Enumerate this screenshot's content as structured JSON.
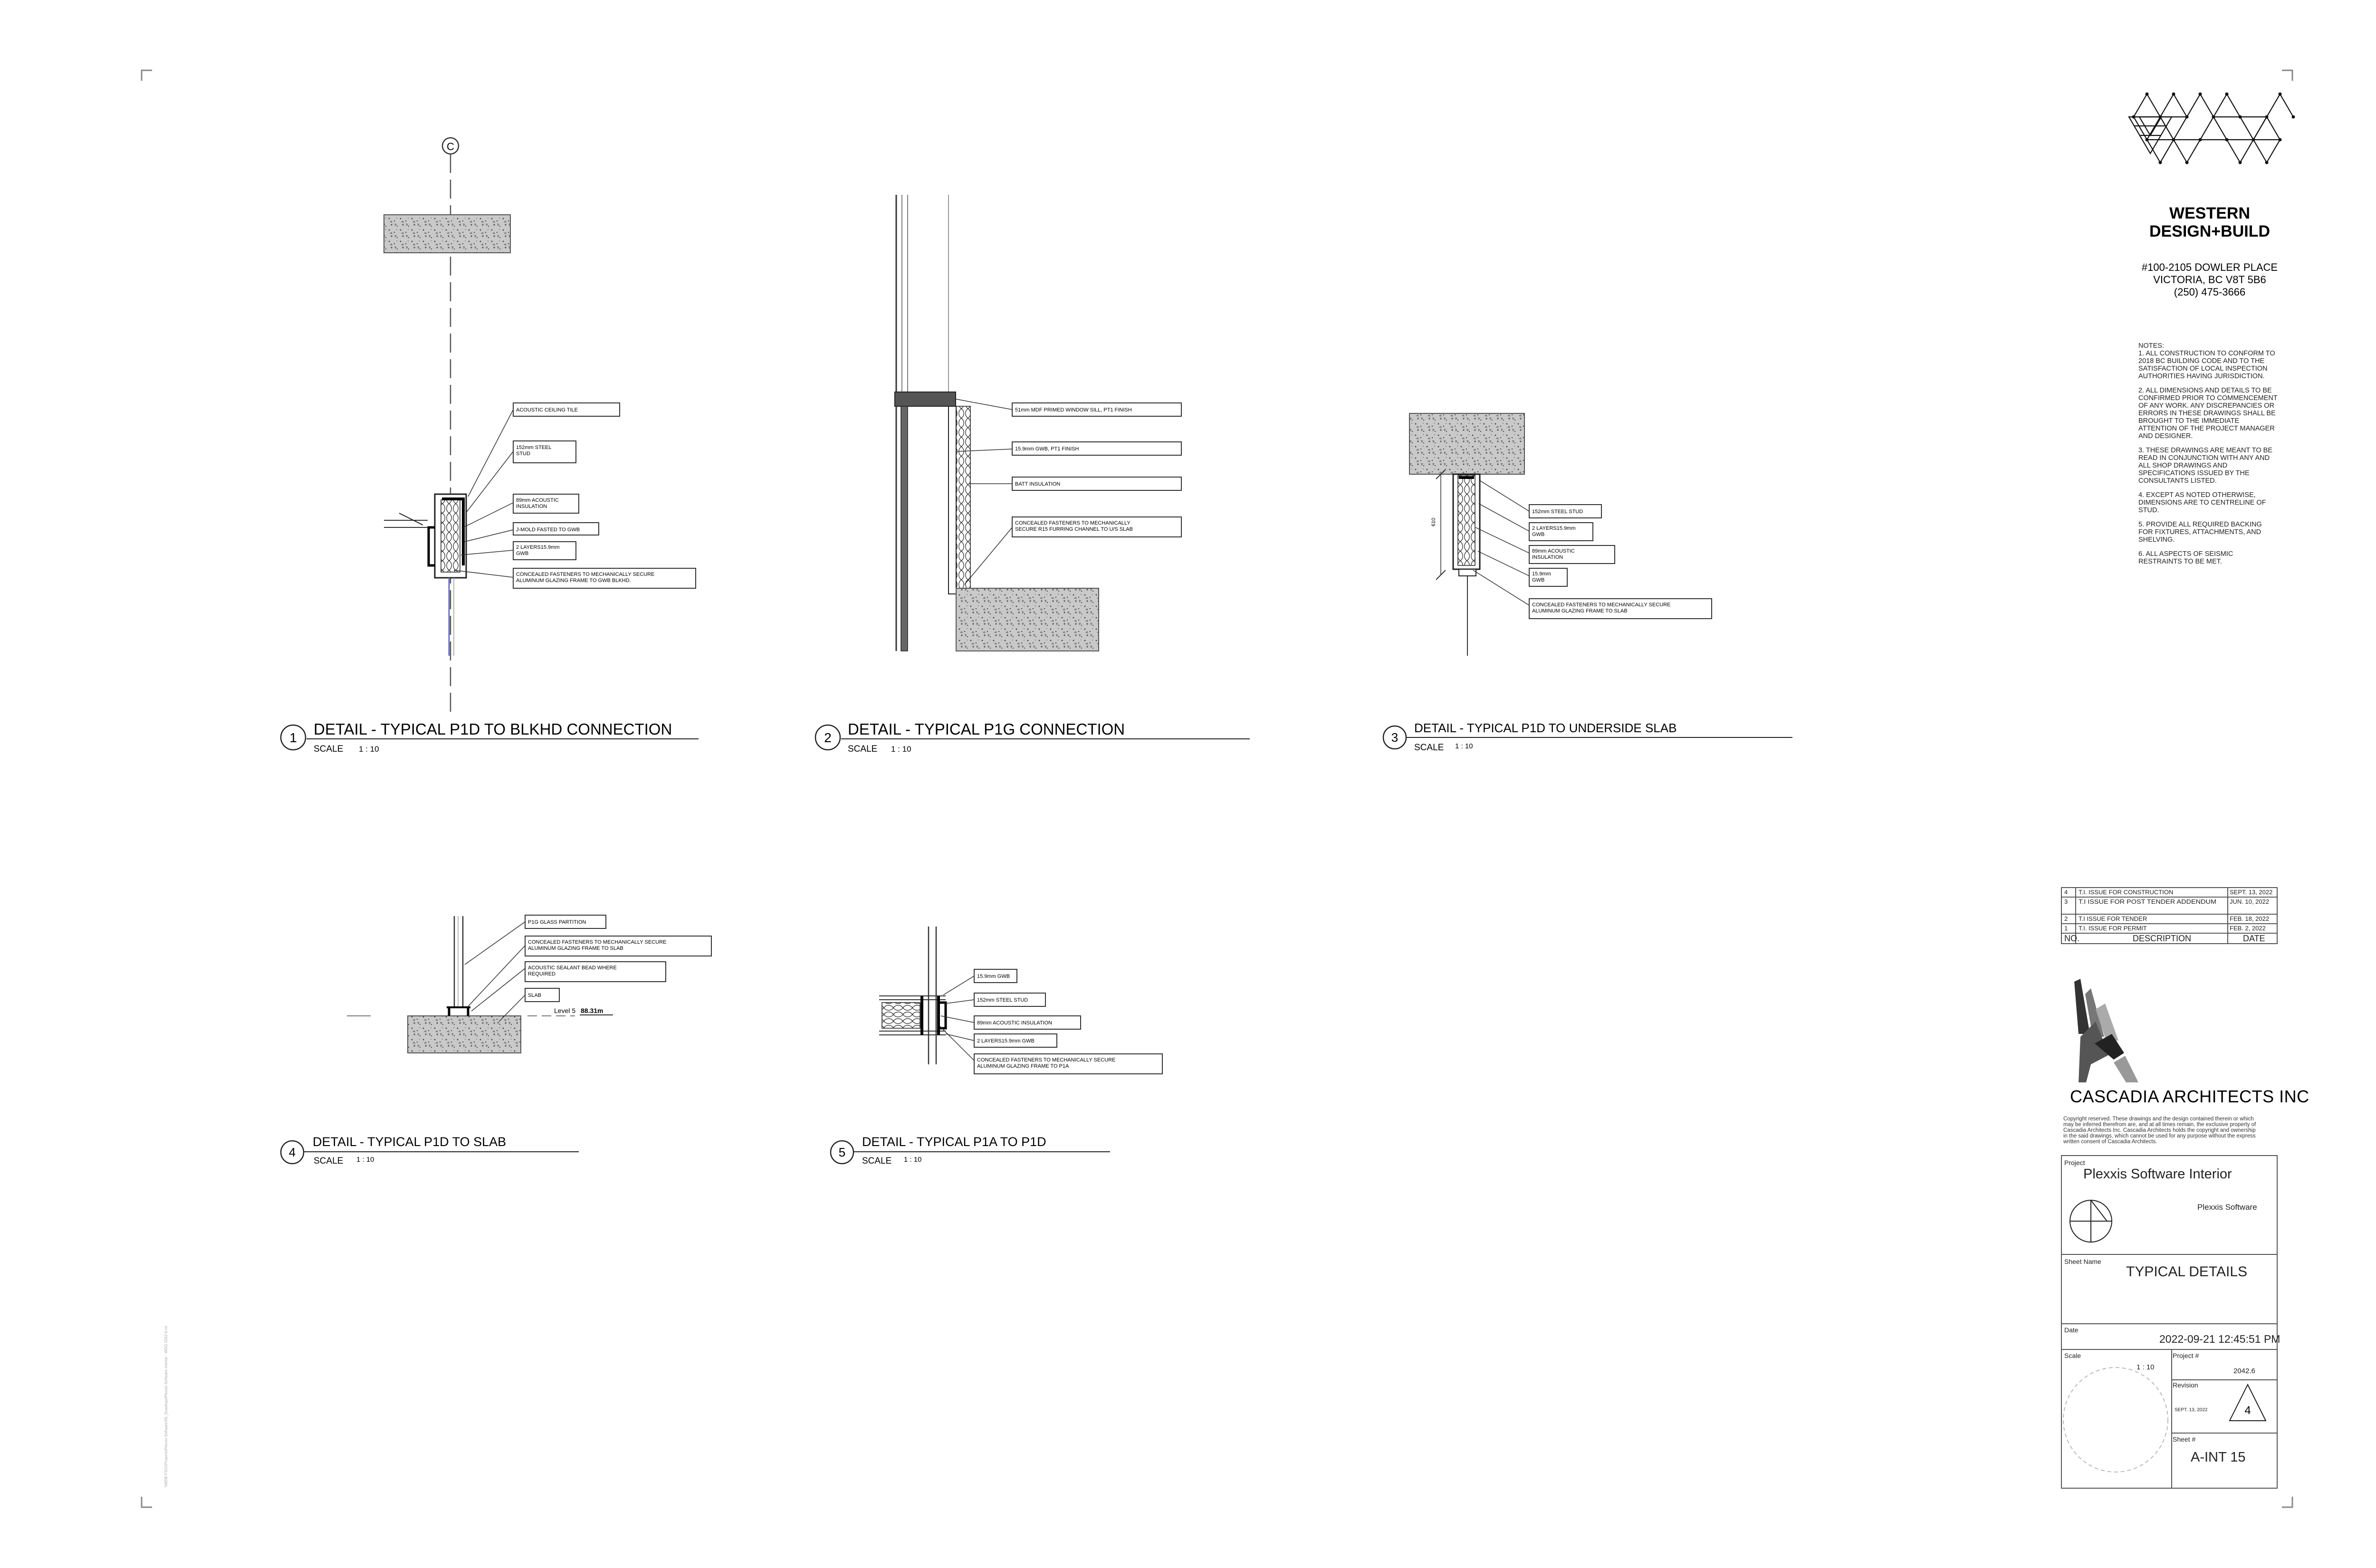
{
  "firm": {
    "name_line1": "WESTERN",
    "name_line2": "DESIGN+BUILD",
    "address1": "#100-2105 DOWLER PLACE",
    "address2": "VICTORIA, BC V8T 5B6",
    "phone": "(250) 475-3666"
  },
  "notes": [
    "NOTES:",
    "1. ALL CONSTRUCTION TO CONFORM TO",
    "2018 BC BUILDING CODE AND TO THE",
    "SATISFACTION OF LOCAL INSPECTION",
    "AUTHORITIES HAVING JURISDICTION.",
    "",
    "2. ALL DIMENSIONS AND DETAILS TO BE",
    "CONFIRMED PRIOR TO COMMENCEMENT",
    "OF ANY WORK. ANY DISCREPANCIES OR",
    "ERRORS IN THESE DRAWINGS SHALL BE",
    "BROUGHT TO THE IMMEDIATE",
    "ATTENTION OF THE PROJECT MANAGER",
    "AND DESIGNER.",
    "",
    "3. THESE DRAWINGS ARE MEANT TO BE",
    "READ IN CONJUNCTION WITH ANY AND",
    "ALL SHOP DRAWINGS AND",
    "SPECIFICATIONS ISSUED BY THE",
    "CONSULTANTS LISTED.",
    "",
    "4. EXCEPT AS NOTED OTHERWISE,",
    "DIMENSIONS ARE TO CENTRELINE OF",
    "STUD.",
    "",
    "5. PROVIDE ALL REQUIRED BACKING",
    "FOR FIXTURES, ATTACHMENTS, AND",
    "SHELVING.",
    "",
    "6. ALL ASPECTS OF SEISMIC",
    "RESTRAINTS TO BE MET."
  ],
  "revisions": {
    "rows": [
      {
        "no": "4",
        "desc": "T.I. ISSUE FOR CONSTRUCTION",
        "date": "SEPT. 13, 2022"
      },
      {
        "no": "3",
        "desc": "T.I ISSUE FOR POST TENDER ADDENDUM",
        "date": "JUN. 10, 2022"
      },
      {
        "no": "2",
        "desc": "T.I ISSUE FOR TENDER",
        "date": "FEB. 18, 2022"
      },
      {
        "no": "1",
        "desc": "T.I. ISSUE FOR PERMIT",
        "date": "FEB. 2, 2022"
      }
    ],
    "header": {
      "no": "NO.",
      "desc": "DESCRIPTION",
      "date": "DATE"
    }
  },
  "architect": {
    "name": "CASCADIA ARCHITECTS INC",
    "copyright": [
      "Copyright reserved. These drawings and the design contained therein or which",
      "may be inferred therefrom are, and at all times remain, the exclusive property of",
      "Cascadia Architects Inc. Cascadia Architects holds the copyright and ownership",
      "in the said drawings, which cannot be used for any purpose without the express",
      "written consent of Cascadia Architects."
    ]
  },
  "titleblock": {
    "project_label": "Project",
    "project_name": "Plexxis Software Interior",
    "client": "Plexxis Software",
    "sheet_name_label": "Sheet Name",
    "sheet_name": "TYPICAL DETAILS",
    "date_label": "Date",
    "date": "2022-09-21 12:45:51 PM",
    "scale_label": "Scale",
    "scale": "1 : 10",
    "project_no_label": "Project #",
    "project_no": "2042.6",
    "revision_label": "Revision",
    "revision_date": "SEPT. 13, 2022",
    "revision_no": "4",
    "sheet_no_label": "Sheet #",
    "sheet_no": "A-INT 15"
  },
  "details": [
    {
      "no": "1",
      "title": "DETAIL - TYPICAL P1D TO BLKHD CONNECTION",
      "scale_label": "SCALE",
      "scale": "1 : 10"
    },
    {
      "no": "2",
      "title": "DETAIL - TYPICAL P1G CONNECTION",
      "scale_label": "SCALE",
      "scale": "1 : 10"
    },
    {
      "no": "3",
      "title": "DETAIL - TYPICAL P1D TO UNDERSIDE SLAB",
      "scale_label": "SCALE",
      "scale": "1 : 10"
    },
    {
      "no": "4",
      "title": "DETAIL - TYPICAL P1D TO SLAB",
      "scale_label": "SCALE",
      "scale": "1 : 10"
    },
    {
      "no": "5",
      "title": "DETAIL - TYPICAL P1A TO P1D",
      "scale_label": "SCALE",
      "scale": "1 : 10"
    }
  ],
  "grid_bubble": "C",
  "callouts": {
    "d1": [
      "ACOUSTIC CEILING TILE",
      "152mm STEEL",
      "STUD",
      "89mm ACOUSTIC",
      "INSULATION",
      "J-MOLD FASTED TO GWB",
      "2 LAYERS15.9mm",
      "GWB",
      "CONCEALED FASTENERS TO MECHANICALLY SECURE",
      "ALUMINUM GLAZING FRAME TO GWB BLKHD."
    ],
    "d2": [
      "51mm MDF PRIMED WINDOW SILL, PT1 FINISH",
      "15.9mm GWB, PT1 FINISH",
      "BATT INSULATION",
      "CONCEALED FASTENERS TO MECHANICALLY",
      "SECURE R15 FURRING CHANNEL TO U/S SLAB"
    ],
    "d3": [
      "152mm STEEL STUD",
      "2 LAYERS15.9mm",
      "GWB",
      "89mm ACOUSTIC",
      "INSULATION",
      "15.9mm",
      "GWB",
      "CONCEALED FASTENERS TO MECHANICALLY SECURE",
      "ALUMINUM GLAZING FRAME TO SLAB"
    ],
    "d4": [
      "P1G GLASS PARTITION",
      "CONCEALED FASTENERS TO MECHANICALLY SECURE",
      "ALUMINUM GLAZING FRAME TO SLAB",
      "ACOUSTIC SEALANT BEAD WHERE",
      "REQUIRED",
      "SLAB"
    ],
    "d5": [
      "15.9mm GWB",
      "152mm STEEL STUD",
      "89mm ACOUSTIC INSULATION",
      "2 LAYERS15.9mm GWB",
      "CONCEALED FASTENERS TO MECHANICALLY SECURE",
      "ALUMINUM GLAZING FRAME TO P1A"
    ]
  },
  "level": {
    "name": "Level 5",
    "value": "88.31m"
  },
  "dim_text": "610",
  "side_path": "\\\\WDB-FS01\\Projects\\Plexxis Software\\05_Drawings\\Plexxis Software Interior - WDG 2042-6.rvt"
}
